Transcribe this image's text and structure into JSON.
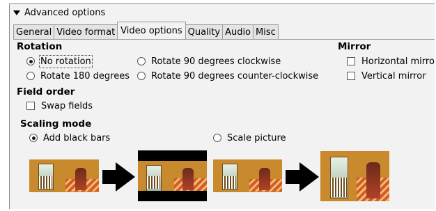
{
  "advanced_options": {
    "label": "Advanced options"
  },
  "tabs": [
    {
      "label": "General",
      "active": false
    },
    {
      "label": "Video format",
      "active": false
    },
    {
      "label": "Video options",
      "active": true
    },
    {
      "label": "Quality",
      "active": false
    },
    {
      "label": "Audio",
      "active": false
    },
    {
      "label": "Misc",
      "active": false
    }
  ],
  "rotation": {
    "heading": "Rotation",
    "no_rotation": "No rotation",
    "rotate_90_cw": "Rotate 90 degrees clockwise",
    "rotate_180": "Rotate 180 degrees",
    "rotate_90_ccw": "Rotate 90 degrees counter-clockwise",
    "selected": "No rotation"
  },
  "mirror": {
    "heading": "Mirror",
    "horizontal": "Horizontal mirro",
    "vertical": "Vertical mirror"
  },
  "field_order": {
    "heading": "Field order",
    "swap_fields": "Swap fields"
  },
  "scaling_mode": {
    "heading": "Scaling mode",
    "add_black_bars": "Add black bars",
    "scale_picture": "Scale picture",
    "selected": "Add black bars"
  }
}
